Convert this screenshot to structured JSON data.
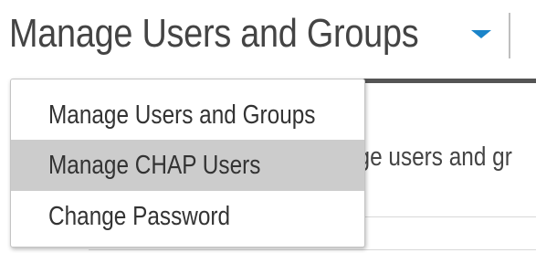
{
  "header": {
    "title": "Manage Users and Groups",
    "dropdown_icon": "chevron-down-icon"
  },
  "page": {
    "description_fragment": "age users and gr"
  },
  "dropdown": {
    "items": [
      {
        "label": "Manage Users and Groups",
        "highlighted": false
      },
      {
        "label": "Manage CHAP Users",
        "highlighted": true
      },
      {
        "label": "Change Password",
        "highlighted": false
      }
    ]
  },
  "colors": {
    "accent": "#1a84c9",
    "highlight": "#cccccc",
    "header_bar": "#555555"
  }
}
